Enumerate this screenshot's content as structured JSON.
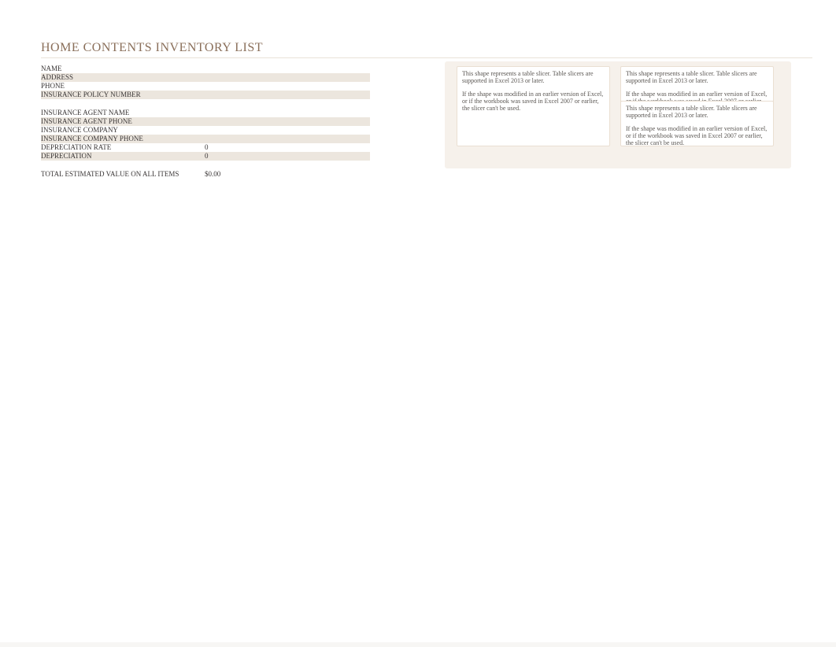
{
  "title": "HOME CONTENTS INVENTORY LIST",
  "info": {
    "rows": [
      {
        "label": "NAME",
        "value": "",
        "alt": false
      },
      {
        "label": "ADDRESS",
        "value": "",
        "alt": true
      },
      {
        "label": "PHONE",
        "value": "",
        "alt": false
      },
      {
        "label": "INSURANCE POLICY NUMBER",
        "value": "",
        "alt": true,
        "gapAfter": true
      },
      {
        "label": "INSURANCE AGENT NAME",
        "value": "",
        "alt": false
      },
      {
        "label": "INSURANCE AGENT PHONE",
        "value": "",
        "alt": true
      },
      {
        "label": "INSURANCE COMPANY",
        "value": "",
        "alt": false
      },
      {
        "label": "INSURANCE COMPANY PHONE",
        "value": "",
        "alt": true
      },
      {
        "label": "DEPRECIATION RATE",
        "value": "0",
        "alt": false
      },
      {
        "label": "DEPRECIATION",
        "value": "0",
        "alt": true,
        "gapAfter": true
      },
      {
        "label": "TOTAL ESTIMATED VALUE ON ALL ITEMS",
        "value": "$0.00",
        "alt": false
      }
    ]
  },
  "slicer_text": {
    "p1": "This shape represents a table slicer. Table slicers are supported in Excel 2013 or later.",
    "p2": "If the shape was modified in an earlier version of Excel, or if the workbook was saved in Excel 2007 or earlier, the slicer can't be used."
  }
}
